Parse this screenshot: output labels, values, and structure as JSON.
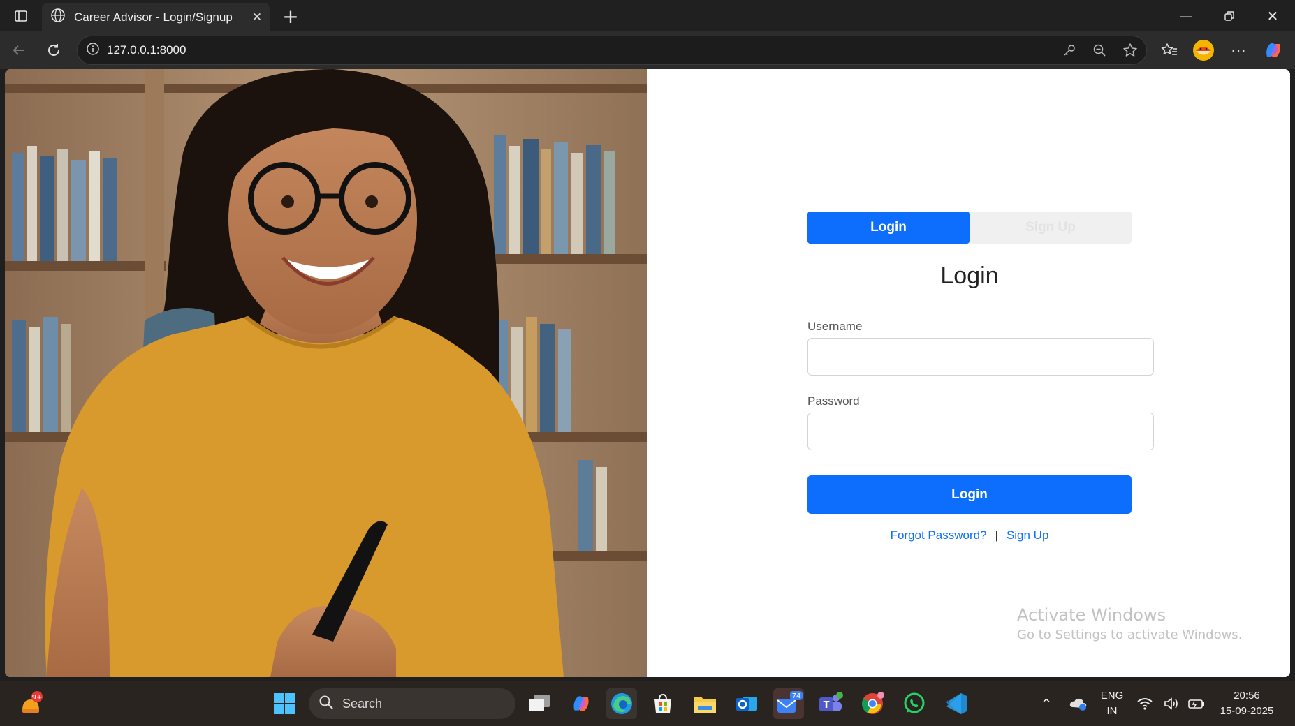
{
  "browser": {
    "tab_title": "Career Advisor - Login/Signup",
    "url": "127.0.0.1:8000"
  },
  "auth": {
    "tab_login": "Login",
    "tab_signup": "Sign Up",
    "heading": "Login",
    "username_label": "Username",
    "username_value": "",
    "password_label": "Password",
    "password_value": "",
    "submit_label": "Login",
    "forgot_link": "Forgot Password?",
    "separator": "|",
    "signup_link": "Sign Up",
    "active_tab": "login",
    "accent_color": "#0d6efd"
  },
  "watermark": {
    "line1": "Activate Windows",
    "line2": "Go to Settings to activate Windows."
  },
  "taskbar": {
    "search_placeholder": "Search",
    "widget_badge": "9+",
    "mail_badge": "74",
    "lang_line1": "ENG",
    "lang_line2": "IN",
    "time": "20:56",
    "date": "15-09-2025"
  }
}
